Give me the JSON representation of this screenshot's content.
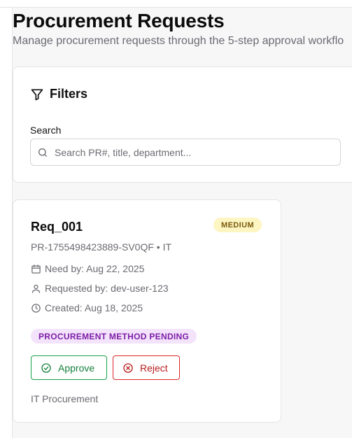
{
  "header": {
    "title": "Procurement Requests",
    "subtitle": "Manage procurement requests through the 5-step approval workflo"
  },
  "filters": {
    "title": "Filters",
    "search_label": "Search",
    "search_placeholder": "Search PR#, title, department...",
    "search_value": "",
    "icons": {
      "filter": "filter-icon",
      "search": "search-icon"
    }
  },
  "requests": [
    {
      "title": "Req_001",
      "priority": "MEDIUM",
      "pr_number": "PR-1755498423889-SV0QF • IT",
      "need_by": "Need by: Aug 22, 2025",
      "requested_by": "Requested by: dev-user-123",
      "created": "Created: Aug 18, 2025",
      "status": "PROCUREMENT METHOD PENDING",
      "approve_label": "Approve",
      "reject_label": "Reject",
      "department": "IT Procurement",
      "icons": {
        "need_by": "calendar-icon",
        "requested_by": "user-icon",
        "created": "clock-icon",
        "approve": "check-circle-icon",
        "reject": "x-circle-icon"
      }
    }
  ],
  "colors": {
    "priority_bg": "#fdf6c3",
    "priority_text": "#7a5b0c",
    "status_bg": "#f3e3fb",
    "status_text": "#7e1fa8",
    "approve": "#15803d",
    "reject": "#b91c1c"
  }
}
